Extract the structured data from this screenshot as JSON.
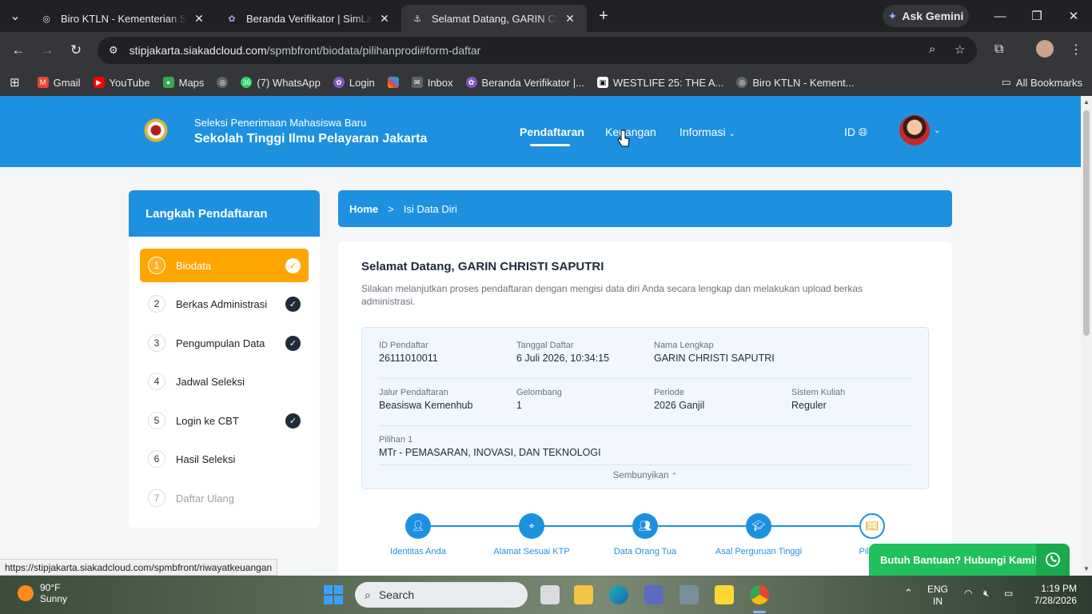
{
  "browser": {
    "tabs": [
      {
        "title": "Biro KTLN - Kementerian Sekret",
        "active": false
      },
      {
        "title": "Beranda Verifikator | SimLala",
        "active": false
      },
      {
        "title": "Selamat Datang, GARIN CHRISTI",
        "active": true
      }
    ],
    "gemini_label": "Ask Gemini",
    "url_host": "stipjakarta.siakadcloud.com",
    "url_path": "/spmbfront/biodata/pilihanprodi#form-daftar",
    "bookmarks": [
      "Gmail",
      "YouTube",
      "Maps",
      "(7) WhatsApp",
      "Login",
      "Inbox",
      "Beranda Verifikator |...",
      "WESTLIFE 25: THE A...",
      "Biro KTLN - Kement..."
    ],
    "whatsapp_badge": "36",
    "all_bookmarks": "All Bookmarks",
    "status_url": "https://stipjakarta.siakadcloud.com/spmbfront/riwayatkeuangan"
  },
  "site": {
    "subtitle": "Seleksi Penerimaan Mahasiswa Baru",
    "title": "Sekolah Tinggi Ilmu Pelayaran Jakarta",
    "menu": [
      "Pendaftaran",
      "Keuangan",
      "Informasi"
    ],
    "lang": "ID"
  },
  "sidebar": {
    "heading": "Langkah Pendaftaran",
    "steps": [
      {
        "num": "1",
        "label": "Biodata",
        "done": true
      },
      {
        "num": "2",
        "label": "Berkas Administrasi",
        "done": true
      },
      {
        "num": "3",
        "label": "Pengumpulan Data",
        "done": true
      },
      {
        "num": "4",
        "label": "Jadwal Seleksi",
        "done": false
      },
      {
        "num": "5",
        "label": "Login ke CBT",
        "done": true
      },
      {
        "num": "6",
        "label": "Hasil Seleksi",
        "done": false
      },
      {
        "num": "7",
        "label": "Daftar Ulang",
        "done": false
      }
    ]
  },
  "breadcrumb": {
    "home": "Home",
    "sep": ">",
    "current": "Isi Data Diri"
  },
  "welcome": {
    "title": "Selamat Datang, GARIN CHRISTI SAPUTRI",
    "desc": "Silakan melanjutkan proses pendaftaran dengan mengisi data diri Anda secara lengkap dan melakukan upload berkas administrasi."
  },
  "info": {
    "id_label": "ID Pendaftar",
    "id_value": "26111010011",
    "date_label": "Tanggal Daftar",
    "date_value": "6 Juli 2026, 10:34:15",
    "name_label": "Nama Lengkap",
    "name_value": "GARIN CHRISTI SAPUTRI",
    "jalur_label": "Jalur Pendaftaran",
    "jalur_value": "Beasiswa Kemenhub",
    "gel_label": "Gelombang",
    "gel_value": "1",
    "periode_label": "Periode",
    "periode_value": "2026 Ganjil",
    "sistem_label": "Sistem Kuliah",
    "sistem_value": "Reguler",
    "pilihan_label": "Pilihan 1",
    "pilihan_value": "MTr - PEMASARAN, INOVASI, DAN TEKNOLOGI",
    "toggle": "Sembunyikan"
  },
  "progress": [
    "Identitas Anda",
    "Alamat Sesuai KTP",
    "Data Orang Tua",
    "Asal Perguruan Tinggi",
    "Pilihan"
  ],
  "help_button": "Butuh Bantuan? Hubungi Kami!",
  "taskbar": {
    "temp": "90°F",
    "weather": "Sunny",
    "search": "Search",
    "lang1": "ENG",
    "lang2": "IN",
    "time": "1:19 PM",
    "date": "7/28/2026"
  }
}
